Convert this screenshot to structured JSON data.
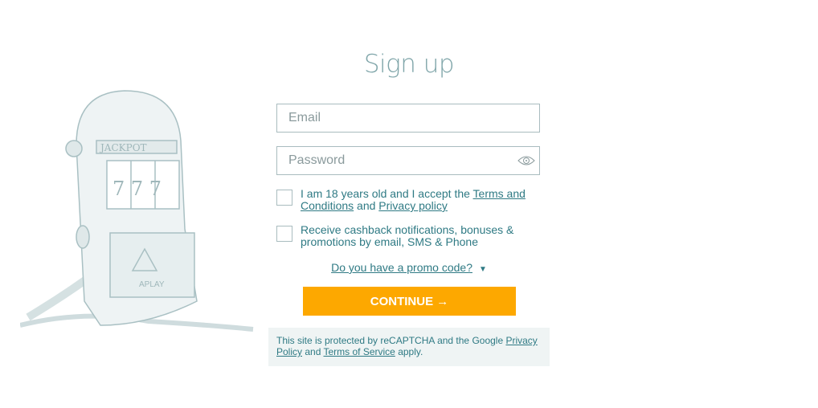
{
  "illustration": {
    "lettering": [
      "JACKPOT",
      "777",
      "APLAY"
    ]
  },
  "title": "Sign up",
  "email": {
    "placeholder": "Email",
    "value": ""
  },
  "password": {
    "placeholder": "Password",
    "value": ""
  },
  "age_consent": {
    "text_before": "I am 18 years old and I accept the ",
    "terms_link": "Terms and Conditions",
    "text_mid": " and ",
    "privacy_link": "Privacy policy",
    "checked": false
  },
  "marketing_consent": {
    "text": "Receive cashback notifications, bonuses & promotions by email, SMS & Phone",
    "checked": false
  },
  "promo": {
    "label": "Do you have a promo code?",
    "arrow": "▼"
  },
  "continue_label": "CONTINUE →",
  "recaptcha": {
    "text_before": "This site is protected by reCAPTCHA and the Google ",
    "privacy_link": "Privacy Policy",
    "text_mid": " and ",
    "terms_link": "Terms of Service",
    "text_after": " apply."
  },
  "colors": {
    "accent": "#fda800",
    "text": "#2f7a84",
    "title": "#7fa5a9",
    "notice_bg": "#eff4f4"
  }
}
